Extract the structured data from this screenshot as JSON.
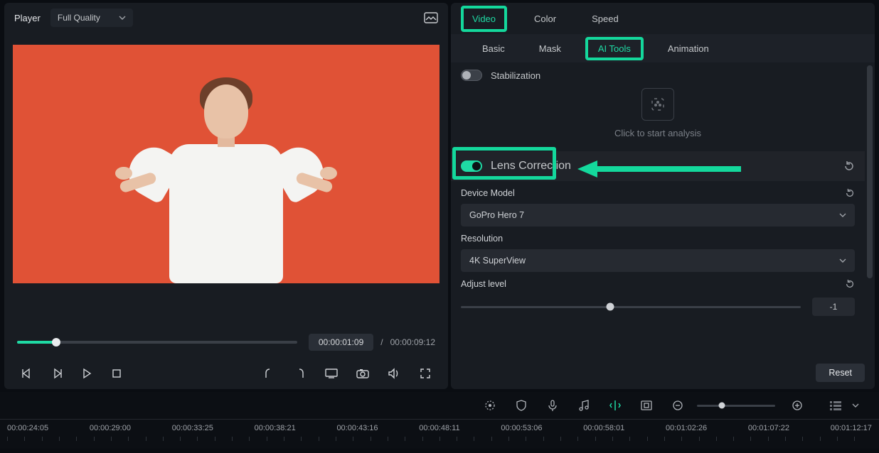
{
  "player": {
    "label": "Player",
    "quality_label": "Full Quality",
    "current_time": "00:00:01:09",
    "separator": "/",
    "total_time": "00:00:09:12",
    "seek_percent": 14
  },
  "inspector": {
    "main_tabs": {
      "video": "Video",
      "color": "Color",
      "speed": "Speed",
      "active": "video"
    },
    "sub_tabs": {
      "basic": "Basic",
      "mask": "Mask",
      "ai_tools": "AI Tools",
      "animation": "Animation",
      "active": "ai_tools"
    },
    "stabilization": {
      "label": "Stabilization",
      "enabled": false,
      "hint": "Click to start analysis"
    },
    "lens_correction": {
      "label": "Lens Correction",
      "enabled": true
    },
    "device_model": {
      "label": "Device Model",
      "value": "GoPro Hero 7"
    },
    "resolution": {
      "label": "Resolution",
      "value": "4K SuperView"
    },
    "adjust_level": {
      "label": "Adjust level",
      "value": "-1",
      "percent": 44
    },
    "reset_button": "Reset"
  },
  "timeline": {
    "labels": [
      "00:00:24:05",
      "00:00:29:00",
      "00:00:33:25",
      "00:00:38:21",
      "00:00:43:16",
      "00:00:48:11",
      "00:00:53:06",
      "00:00:58:01",
      "00:01:02:26",
      "00:01:07:22",
      "00:01:12:17"
    ]
  }
}
